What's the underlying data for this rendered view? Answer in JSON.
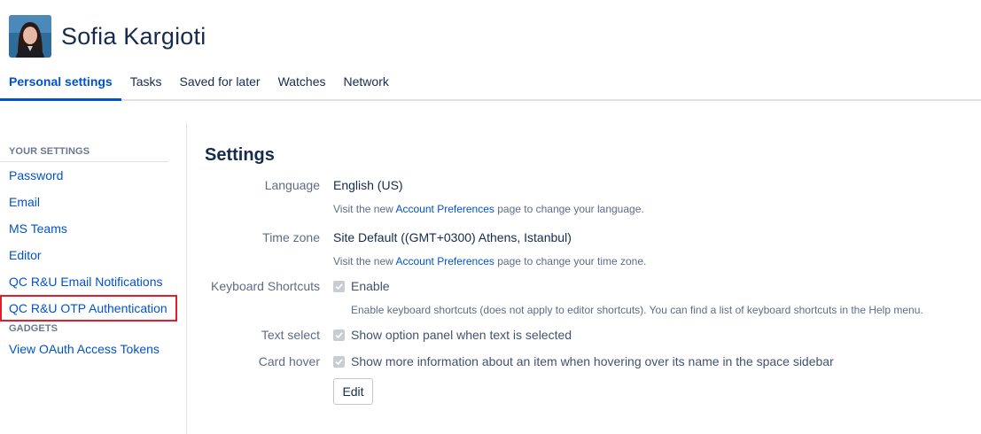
{
  "user": {
    "name": "Sofia Kargioti"
  },
  "tabs": [
    {
      "label": "Personal settings",
      "active": true
    },
    {
      "label": "Tasks"
    },
    {
      "label": "Saved for later"
    },
    {
      "label": "Watches"
    },
    {
      "label": "Network"
    }
  ],
  "sidebar": {
    "your_settings_heading": "YOUR SETTINGS",
    "items": [
      {
        "label": "Password"
      },
      {
        "label": "Email"
      },
      {
        "label": "MS Teams"
      },
      {
        "label": "Editor"
      },
      {
        "label": "QC R&U Email Notifications"
      },
      {
        "label": "QC R&U OTP Authentication",
        "highlighted": true
      }
    ],
    "gadgets_heading": "GADGETS",
    "gadget_items": [
      {
        "label": "View OAuth Access Tokens"
      }
    ]
  },
  "settings": {
    "title": "Settings",
    "language": {
      "label": "Language",
      "value": "English (US)",
      "hint_prefix": "Visit the new ",
      "hint_link": "Account Preferences",
      "hint_suffix": " page to change your language."
    },
    "timezone": {
      "label": "Time zone",
      "value": "Site Default ((GMT+0300) Athens, Istanbul)",
      "hint_prefix": "Visit the new ",
      "hint_link": "Account Preferences",
      "hint_suffix": " page to change your time zone."
    },
    "keyboard": {
      "label": "Keyboard Shortcuts",
      "checkbox_label": "Enable",
      "hint": "Enable keyboard shortcuts (does not apply to editor shortcuts). You can find a list of keyboard shortcuts in the Help menu."
    },
    "text_select": {
      "label": "Text select",
      "checkbox_label": "Show option panel when text is selected"
    },
    "card_hover": {
      "label": "Card hover",
      "checkbox_label": "Show more information about an item when hovering over its name in the space sidebar"
    },
    "edit_button": "Edit"
  },
  "colors": {
    "accent": "#0052cc",
    "highlight_outline": "#e01f2a",
    "text": "#172b4d",
    "muted": "#5e6c84",
    "divider": "#dfe1e6"
  }
}
